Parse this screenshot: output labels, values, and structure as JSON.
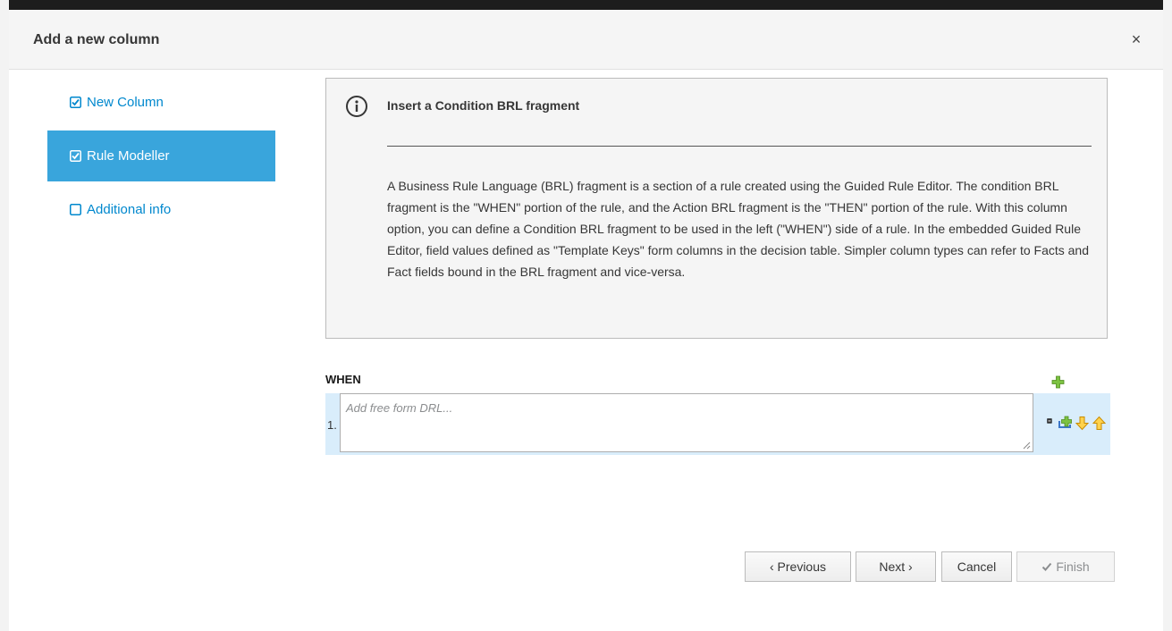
{
  "modal": {
    "title": "Add a new column",
    "close_label": "×"
  },
  "wizard": {
    "steps": [
      {
        "label": "New Column",
        "checked": true,
        "active": false
      },
      {
        "label": "Rule Modeller",
        "checked": true,
        "active": true
      },
      {
        "label": "Additional info",
        "checked": false,
        "active": false
      }
    ]
  },
  "info": {
    "title": "Insert a Condition BRL fragment",
    "body": "A Business Rule Language (BRL) fragment is a section of a rule created using the Guided Rule Editor. The condition BRL fragment is the \"WHEN\" portion of the rule, and the Action BRL fragment is the \"THEN\" portion of the rule. With this column option, you can define a Condition BRL fragment to be used in the left (\"WHEN\") side of a rule. In the embedded Guided Rule Editor, field values defined as \"Template Keys\" form columns in the decision table. Simpler column types can refer to Facts and Fact fields bound in the BRL fragment and vice-versa."
  },
  "rule": {
    "section_label": "WHEN",
    "rows": [
      {
        "number": "1.",
        "placeholder": "Add free form DRL...",
        "value": ""
      }
    ]
  },
  "footer": {
    "previous_label": "‹ Previous",
    "next_label": "Next ›",
    "cancel_label": "Cancel",
    "finish_label": "Finish"
  },
  "colors": {
    "accent": "#39a5dc",
    "link": "#0088ce",
    "row_bg": "#d9edfb"
  },
  "icons": {
    "info": "info-circle-icon",
    "add": "green-plus-icon",
    "remove": "minus-square-icon",
    "insert_below": "insert-below-icon",
    "move_down": "arrow-down-icon",
    "move_up": "arrow-up-icon",
    "finish": "checkmark-icon"
  }
}
